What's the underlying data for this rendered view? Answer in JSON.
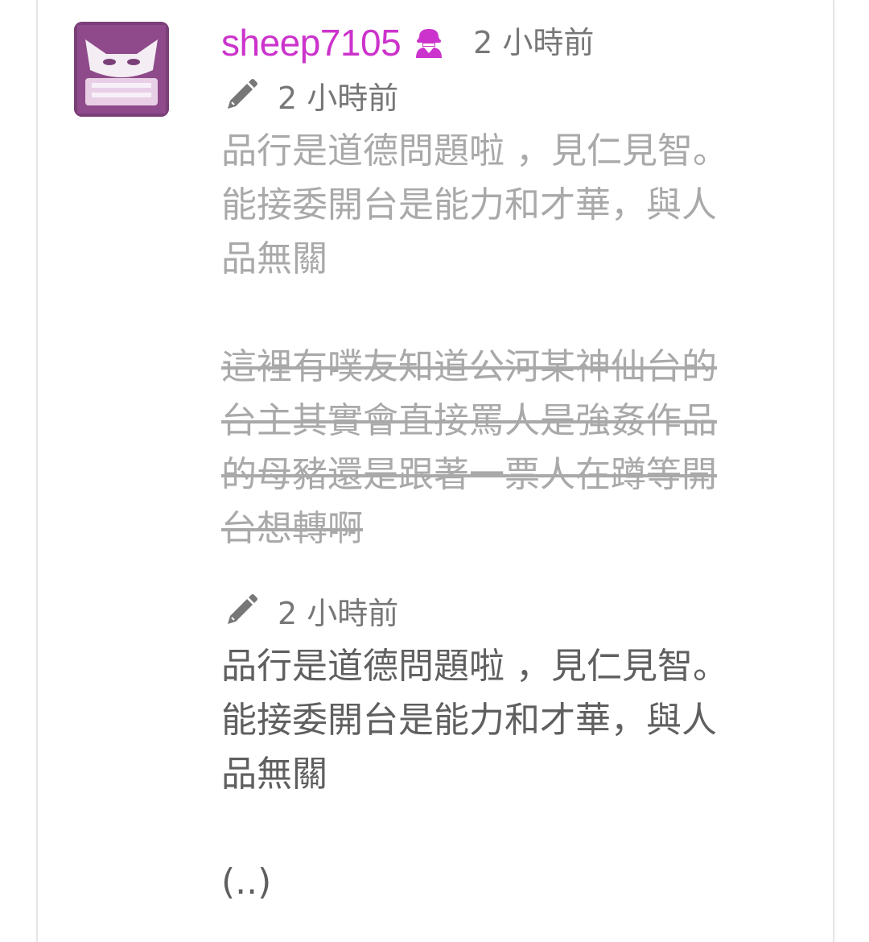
{
  "post": {
    "username": "sheep7105",
    "badge_icon": "hacker-badge-icon",
    "time": "2 小時前",
    "username_color": "#cc33cc"
  },
  "edits": [
    {
      "time": "2 小時前",
      "lines": [
        "品行是道德問題啦 ，見仁見智。",
        "能接委開台是能力和才華，與人",
        "品無關"
      ],
      "struck_lines": [
        "這裡有噗友知道公河某神仙台的",
        "台主其實會直接罵人是強姦作品",
        "的母豬還是跟著一票人在蹲等開",
        "台想轉啊"
      ]
    },
    {
      "time": "2 小時前",
      "lines": [
        "品行是道德問題啦 ，見仁見智。",
        "能接委開台是能力和才華，與人",
        "品無關"
      ],
      "trailing": "(..)"
    }
  ]
}
